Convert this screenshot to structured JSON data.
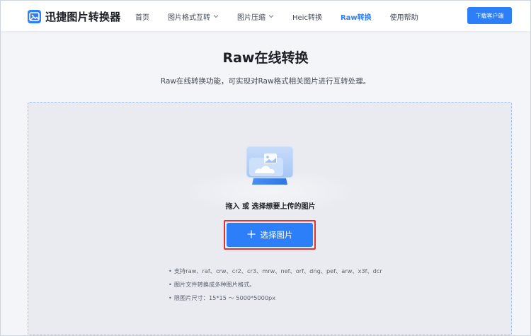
{
  "brand": {
    "name": "迅捷图片转换器",
    "color": "#2d7ff9"
  },
  "nav": {
    "items": [
      {
        "label": "首页",
        "dropdown": false,
        "active": false
      },
      {
        "label": "图片格式互转",
        "dropdown": true,
        "active": false
      },
      {
        "label": "图片压缩",
        "dropdown": true,
        "active": false
      },
      {
        "label": "Heic转换",
        "dropdown": false,
        "active": false
      },
      {
        "label": "Raw转换",
        "dropdown": false,
        "active": true
      },
      {
        "label": "使用帮助",
        "dropdown": false,
        "active": false
      }
    ],
    "download_label": "下载客户端"
  },
  "page": {
    "title": "Raw在线转换",
    "subtitle": "Raw在线转换功能，可实现对Raw格式相关图片进行互转处理。"
  },
  "upload": {
    "hint": "拖入 或 选择想要上传的图片",
    "button_label": "选择图片",
    "icon": "image-upload-icon",
    "notes": [
      "支持raw、raf、crw、cr2、cr3、mrw、nef、orf、dng、pef、arw、x3f、dcr",
      "图片文件转换成多种图片格式。",
      "限图片尺寸：15*15 ～ 5000*5000px"
    ]
  },
  "colors": {
    "accent": "#2d7ff9",
    "highlight_outline": "#e0323a",
    "dropzone_bg": "#e9ebf1",
    "dropzone_border": "#9ec1f3"
  }
}
